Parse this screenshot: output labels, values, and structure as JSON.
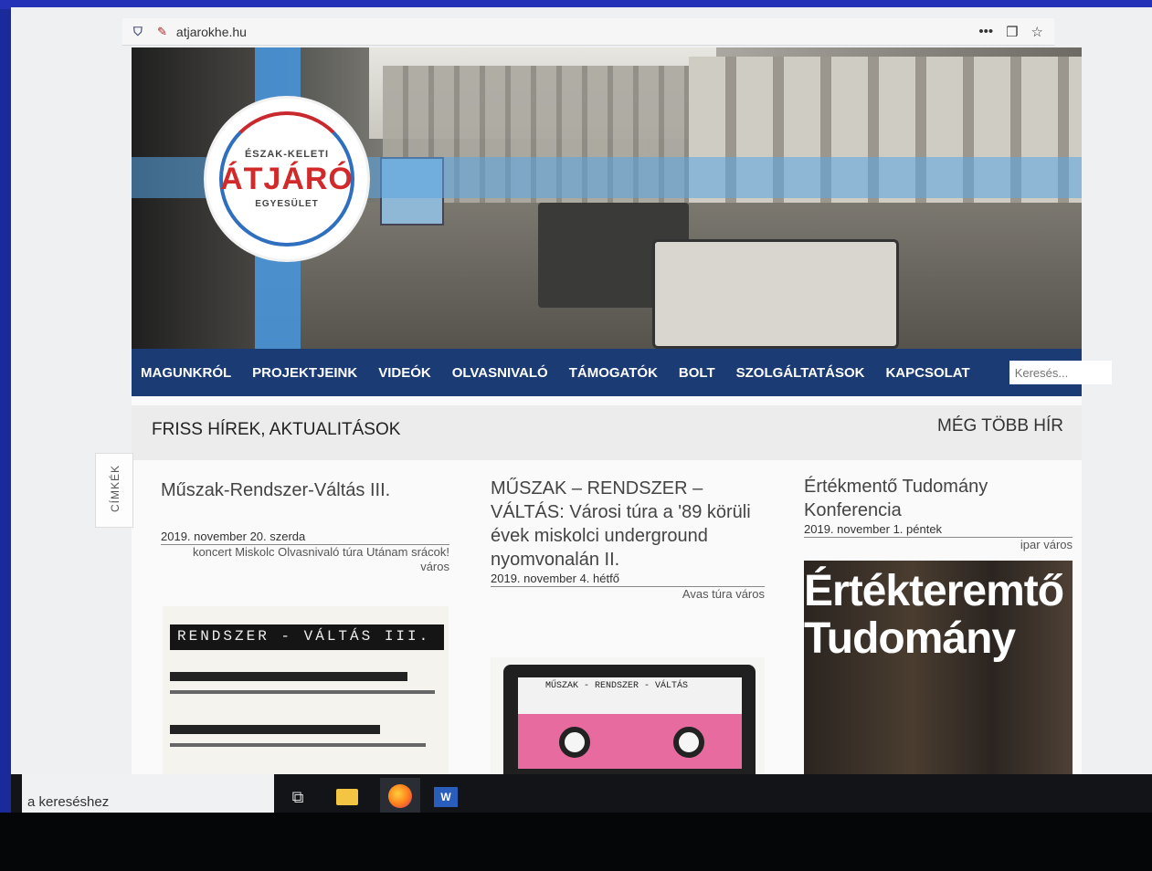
{
  "browser": {
    "url": "atjarokhe.hu",
    "shield_icon": "tracking-protection-icon",
    "site_icon": "site-settings-icon",
    "more_glyph": "•••",
    "pocket_glyph": "❐",
    "bookmark_glyph": "☆"
  },
  "logo": {
    "top": "ÉSZAK-KELETI",
    "main": "ÁTJÁRÓ",
    "bottom": "EGYESÜLET",
    "accent_red": "#d22a2a",
    "accent_blue": "#2f6fbf"
  },
  "nav": {
    "items": [
      "MAGUNKRÓL",
      "PROJEKTJEINK",
      "VIDEÓK",
      "OLVASNIVALÓ",
      "TÁMOGATÓK",
      "BOLT",
      "SZOLGÁLTATÁSOK",
      "KAPCSOLAT"
    ],
    "language_icon": "uk-flag-icon",
    "search_placeholder": "Keresés...",
    "background": "#1a3b73"
  },
  "news": {
    "heading": "FRISS HÍREK, AKTUALITÁSOK",
    "more_link": "MÉG TÖBB HÍR",
    "tags_tab": "CÍMKÉK"
  },
  "articles": [
    {
      "title": "Műszak-Rendszer-Váltás III.",
      "date": "2019. november 20. szerda",
      "tags": "koncert Miskolc Olvasnivaló túra Utánam srácok! város",
      "thumb_text": "RENDSZER - VÁLTÁS III."
    },
    {
      "title": "MŰSZAK – RENDSZER – VÁLTÁS: Városi túra a '89 körüli évek miskolci underground nyomvonalán II.",
      "date": "2019. november 4. hétfő",
      "tags": "Avas túra város",
      "thumb_text": "MŰSZAK - RENDSZER - VÁLTÁS"
    },
    {
      "title": "Értékmentő Tudomány Konferencia",
      "date": "2019. november 1. péntek",
      "tags": "ipar város",
      "thumb_line1": "Értékteremtő",
      "thumb_line2": "Tudomány"
    }
  ],
  "taskbar": {
    "search_text": "a kereséshez",
    "apps": [
      "task-view-icon",
      "file-explorer-icon",
      "firefox-icon",
      "word-icon"
    ]
  }
}
